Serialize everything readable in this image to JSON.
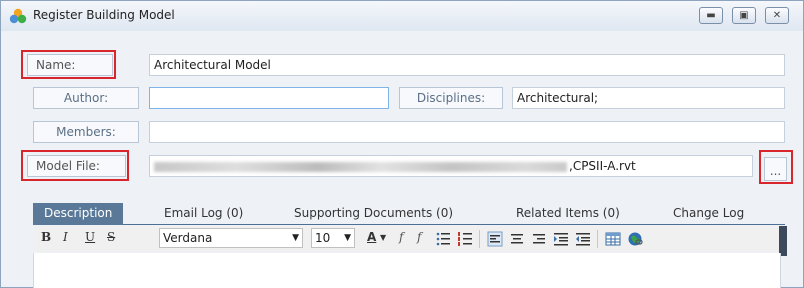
{
  "window": {
    "title": "Register Building Model",
    "controls": [
      "minimize",
      "restore",
      "close"
    ]
  },
  "form": {
    "name_label": "Name:",
    "name_value": "Architectural Model",
    "author_label": "Author:",
    "author_value": "",
    "disciplines_label": "Disciplines:",
    "disciplines_value": "Architectural;",
    "members_label": "Members:",
    "members_value": "",
    "model_file_label": "Model File:",
    "model_file_value_suffix": ",CPSII-A.rvt",
    "browse_label": "..."
  },
  "tabs": [
    {
      "label": "Description",
      "active": true
    },
    {
      "label": "Email Log (0)",
      "active": false
    },
    {
      "label": "Supporting Documents (0)",
      "active": false
    },
    {
      "label": "Related Items (0)",
      "active": false
    },
    {
      "label": "Change Log",
      "active": false
    }
  ],
  "toolbar": {
    "bold": "B",
    "italic": "I",
    "underline": "U",
    "strike": "S",
    "font_family": "Verdana",
    "font_size": "10",
    "font_color_glyph": "A",
    "format_glyph": "f",
    "clear_format_glyph": "f"
  },
  "colors": {
    "highlight": "#d8262c",
    "active_tab": "#5a7898",
    "accent": "#7eb4ea"
  }
}
